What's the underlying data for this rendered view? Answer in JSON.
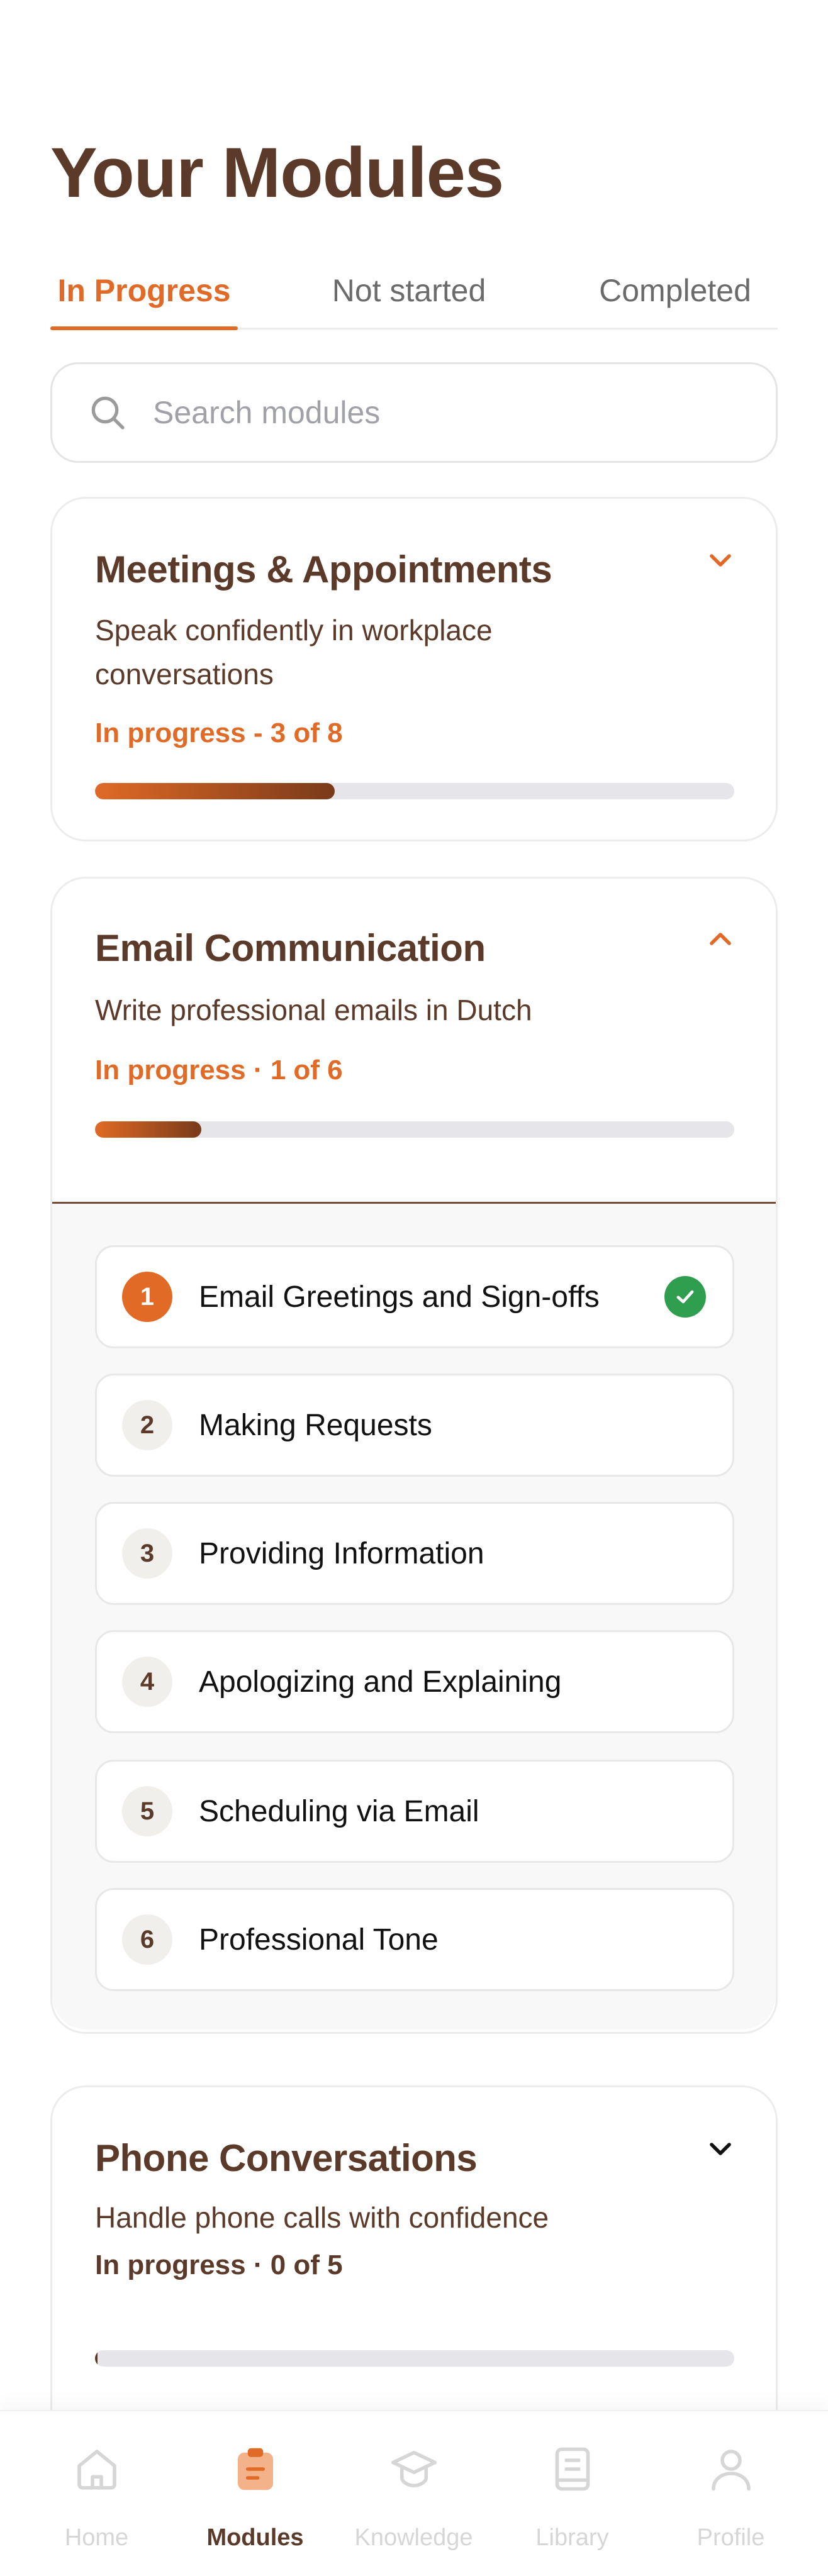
{
  "page": {
    "title": "Your Modules"
  },
  "tabs": [
    {
      "label": "In Progress",
      "active": true
    },
    {
      "label": "Not started",
      "active": false
    },
    {
      "label": "Completed",
      "active": false
    }
  ],
  "search": {
    "placeholder": "Search modules",
    "value": "",
    "icon": "search-icon"
  },
  "modules": [
    {
      "title": "Meetings & Appointments",
      "description": "Speak confidently in workplace conversations",
      "status": "In progress - 3 of 8",
      "progress": 0.375,
      "expanded": false,
      "chevron": "chevron-down-icon"
    },
    {
      "title": "Email Communication",
      "description": "Write professional emails in Dutch",
      "status": "In progress · 1 of 6",
      "progress": 0.1667,
      "expanded": true,
      "chevron": "chevron-up-icon",
      "lessons": [
        {
          "number": "1",
          "label": "Email Greetings and Sign-offs",
          "completed": true
        },
        {
          "number": "2",
          "label": "Making Requests",
          "completed": false
        },
        {
          "number": "3",
          "label": "Providing Information",
          "completed": false
        },
        {
          "number": "4",
          "label": "Apologizing and Explaining",
          "completed": false
        },
        {
          "number": "5",
          "label": "Scheduling via Email",
          "completed": false
        },
        {
          "number": "6",
          "label": "Professional Tone",
          "completed": false
        }
      ]
    },
    {
      "title": "Phone Conversations",
      "description": "Handle phone calls with confidence",
      "status": "In progress · 0 of 5",
      "progress": 0,
      "expanded": false,
      "chevron": "chevron-down-icon"
    }
  ],
  "nav": [
    {
      "label": "Home",
      "icon": "home-icon",
      "active": false
    },
    {
      "label": "Modules",
      "icon": "clipboard-icon",
      "active": true
    },
    {
      "label": "Knowledge",
      "icon": "graduation-cap-icon",
      "active": false
    },
    {
      "label": "Library",
      "icon": "book-icon",
      "active": false
    },
    {
      "label": "Profile",
      "icon": "user-icon",
      "active": false
    }
  ],
  "colors": {
    "accent": "#e06a26",
    "text": "#5b3a2a",
    "success": "#2f9e4f",
    "track": "#e5e5ea"
  }
}
